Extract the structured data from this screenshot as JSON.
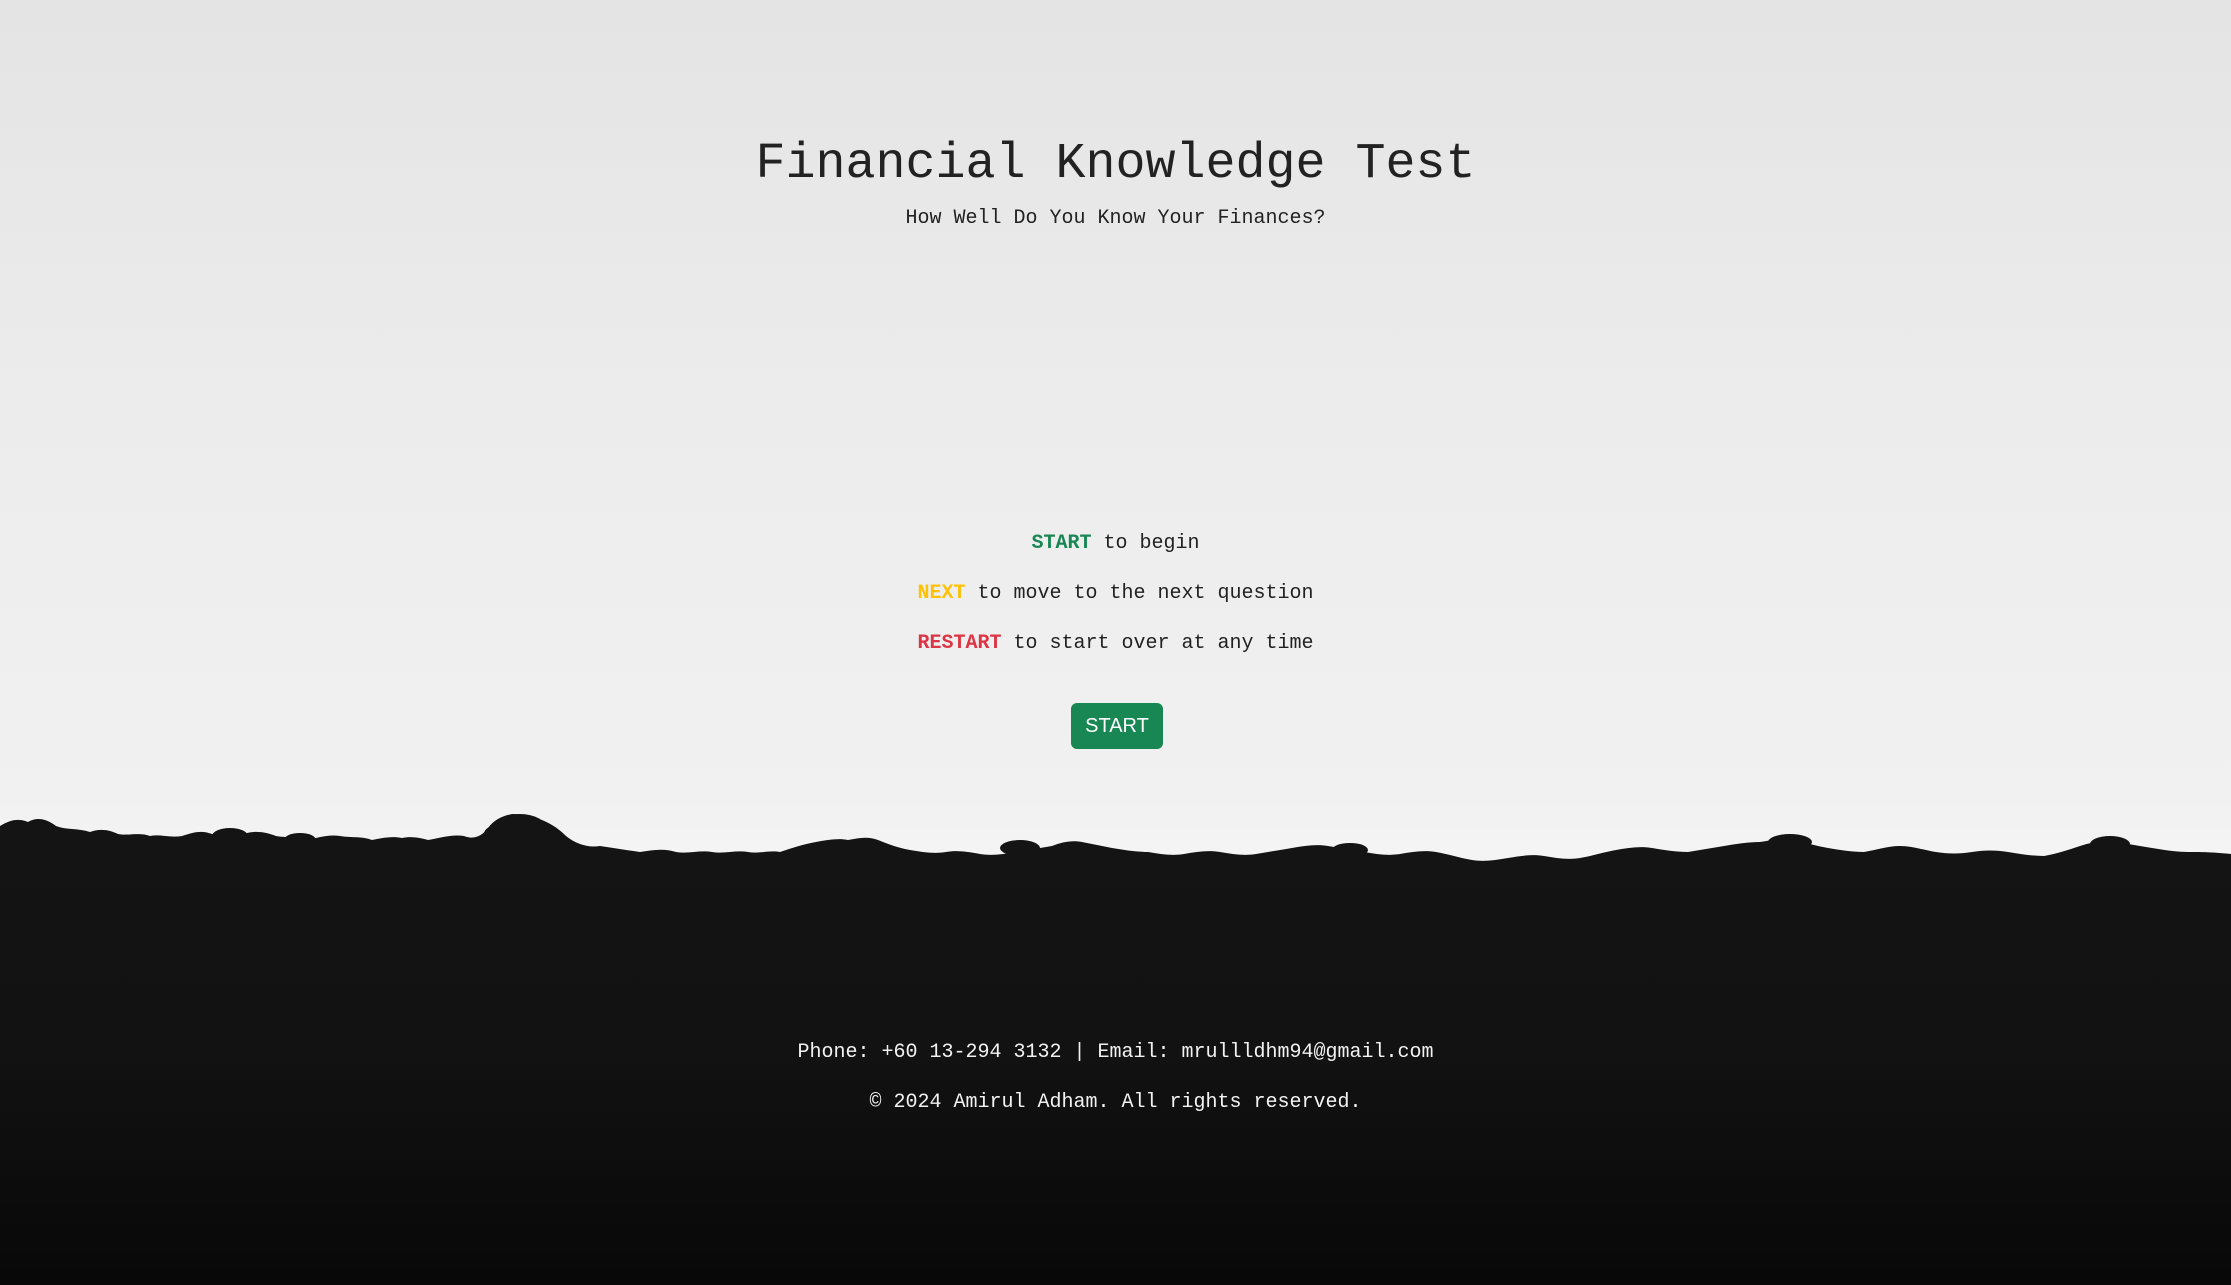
{
  "header": {
    "title": "Financial Knowledge Test",
    "subtitle": "How Well Do You Know Your Finances?"
  },
  "instructions": [
    {
      "keyword": "START",
      "text": " to begin",
      "color": "#198754"
    },
    {
      "keyword": "NEXT",
      "text": " to move to the next question",
      "color": "#ffc107"
    },
    {
      "keyword": "RESTART",
      "text": " to start over at any time",
      "color": "#dc3545"
    }
  ],
  "start_button": {
    "label": "START",
    "color": "#198754"
  },
  "footer": {
    "contact": "Phone: +60 13-294 3132 | Email: mrullldhm94@gmail.com",
    "copyright": "© 2024 Amirul Adham. All rights reserved."
  },
  "background": {
    "sky": "#ececec",
    "ground": "#111111"
  }
}
